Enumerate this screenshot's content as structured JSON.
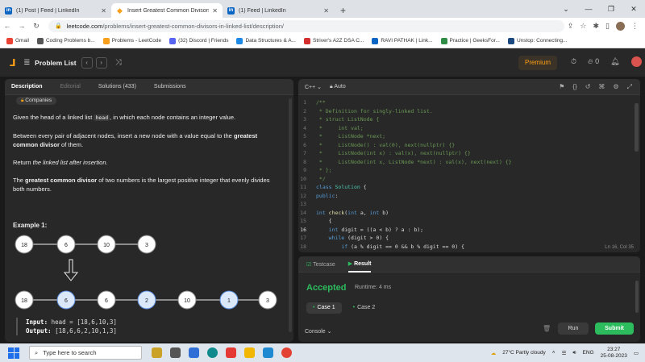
{
  "browser": {
    "tabs": [
      {
        "label": "(1) Post | Feed | LinkedIn",
        "favicon": "in"
      },
      {
        "label": "Insert Greatest Common Divisors",
        "favicon": "lc",
        "active": true
      },
      {
        "label": "(1) Feed | LinkedIn",
        "favicon": "in"
      }
    ],
    "new_tab": "+",
    "url_host": "leetcode.com",
    "url_path": "/problems/insert-greatest-common-divisors-in-linked-list/description/",
    "bookmarks": [
      {
        "label": "Gmail",
        "color": "#ea4335"
      },
      {
        "label": "Coding Problems b...",
        "color": "#555555"
      },
      {
        "label": "Problems - LeetCode",
        "color": "#f89f1b"
      },
      {
        "label": "(32) Discord | Friends",
        "color": "#5865f2"
      },
      {
        "label": "Data Structures & A...",
        "color": "#1e88e5"
      },
      {
        "label": "Striver's A2Z DSA C...",
        "color": "#d32f2f"
      },
      {
        "label": "RAVI PATHAK | Link...",
        "color": "#0a66c2"
      },
      {
        "label": "Practice | GeeksFor...",
        "color": "#2f8d46"
      },
      {
        "label": "Unstop: Connecting...",
        "color": "#1c4980"
      }
    ]
  },
  "nav": {
    "problem_list": "Problem List",
    "premium": "Premium",
    "streak": "0"
  },
  "left": {
    "tabs": [
      "Description",
      "Editorial",
      "Solutions (433)",
      "Submissions"
    ],
    "companies": "Companies",
    "desc": {
      "p1a": "Given the head of a linked list ",
      "p1code": "head",
      "p1b": ", in which each node contains an integer value.",
      "p2a": "Between every pair of adjacent nodes, insert a new node with a value equal to the ",
      "p2b": "greatest common divisor",
      "p2c": " of them.",
      "p3a": "Return ",
      "p3b": "the linked list after insertion",
      "p3c": ".",
      "p4a": "The ",
      "p4b": "greatest common divisor",
      "p4c": " of two numbers is the largest positive integer that evenly divides both numbers."
    },
    "example_title": "Example 1:",
    "input_label": "Input:",
    "input_value": " head = [18,6,10,3]",
    "output_label": "Output:",
    "output_value": " [18,6,6,2,10,1,3]"
  },
  "diagram": {
    "top": [
      "18",
      "6",
      "10",
      "3"
    ],
    "bottom": [
      {
        "v": "18",
        "new": false
      },
      {
        "v": "6",
        "new": true
      },
      {
        "v": "6",
        "new": false
      },
      {
        "v": "2",
        "new": true
      },
      {
        "v": "10",
        "new": false
      },
      {
        "v": "1",
        "new": true
      },
      {
        "v": "3",
        "new": false
      }
    ]
  },
  "editor": {
    "language": "C++",
    "auto": "Auto",
    "cursor": "Ln 16, Col 35"
  },
  "bottom": {
    "tabs": [
      "Testcase",
      "Result"
    ],
    "status": "Accepted",
    "runtime": "Runtime: 4 ms",
    "cases": [
      "Case 1",
      "Case 2"
    ],
    "console": "Console",
    "run": "Run",
    "submit": "Submit"
  },
  "taskbar": {
    "search_placeholder": "Type here to search",
    "weather": "27°C  Partly cloudy",
    "lang": "ENG",
    "time": "23:27",
    "date": "25-08-2023"
  }
}
